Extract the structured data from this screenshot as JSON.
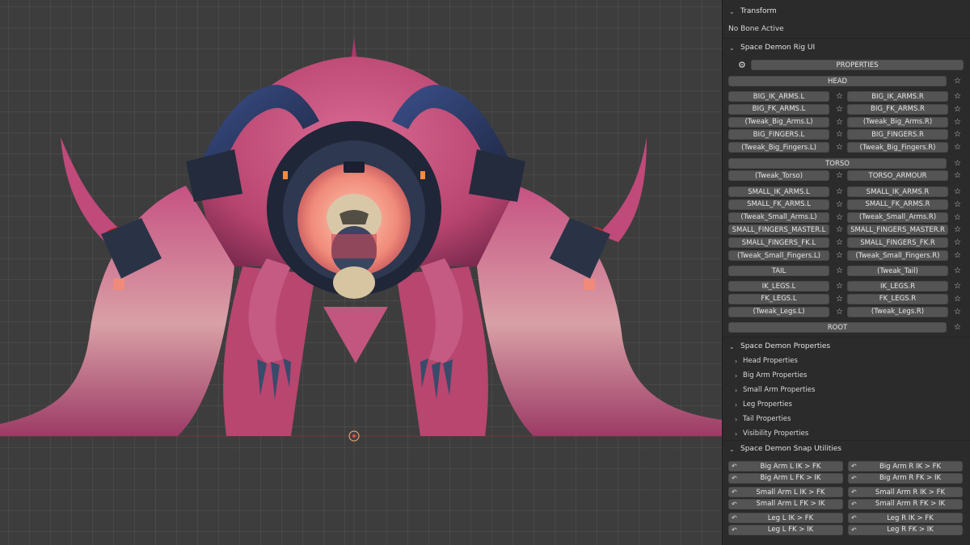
{
  "viewport": {
    "scene_subject": "space-demon-creature-model",
    "colors": {
      "skin": "#c8507e",
      "armour": "#2a3346",
      "glow": "#f08a7a",
      "background": "#3d3d3d"
    }
  },
  "panel": {
    "transform": {
      "title": "Transform",
      "status": "No Bone Active"
    },
    "rig_ui": {
      "title": "Space Demon Rig UI",
      "properties_label": "PROPERTIES",
      "head_label": "HEAD",
      "big_rows": [
        [
          "BIG_IK_ARMS.L",
          "BIG_IK_ARMS.R"
        ],
        [
          "BIG_FK_ARMS.L",
          "BIG_FK_ARMS.R"
        ],
        [
          "(Tweak_Big_Arms.L)",
          "(Tweak_Big_Arms.R)"
        ],
        [
          "BIG_FINGERS.L",
          "BIG_FINGERS.R"
        ],
        [
          "(Tweak_Big_Fingers.L)",
          "(Tweak_Big_Fingers.R)"
        ]
      ],
      "torso_label": "TORSO",
      "torso_row": [
        "(Tweak_Torso)",
        "TORSO_ARMOUR"
      ],
      "small_rows": [
        [
          "SMALL_IK_ARMS.L",
          "SMALL_IK_ARMS.R"
        ],
        [
          "SMALL_FK_ARMS.L",
          "SMALL_FK_ARMS.R"
        ],
        [
          "(Tweak_Small_Arms.L)",
          "(Tweak_Small_Arms.R)"
        ],
        [
          "SMALL_FINGERS_MASTER.L",
          "SMALL_FINGERS_MASTER.R"
        ],
        [
          "SMALL_FINGERS_FK.L",
          "SMALL_FINGERS_FK.R"
        ],
        [
          "(Tweak_Small_Fingers.L)",
          "(Tweak_Small_Fingers.R)"
        ]
      ],
      "tail_row": [
        "TAIL",
        "(Tweak_Tail)"
      ],
      "leg_rows": [
        [
          "IK_LEGS.L",
          "IK_LEGS.R"
        ],
        [
          "FK_LEGS.L",
          "FK_LEGS.R"
        ],
        [
          "(Tweak_Legs.L)",
          "(Tweak_Legs.R)"
        ]
      ],
      "root_label": "ROOT"
    },
    "properties": {
      "title": "Space Demon Properties",
      "items": [
        "Head Properties",
        "Big Arm Properties",
        "Small Arm Properties",
        "Leg Properties",
        "Tail Properties",
        "Visibility Properties"
      ]
    },
    "snap": {
      "title": "Space Demon Snap Utilities",
      "groups": [
        [
          [
            "Big Arm L IK > FK",
            "Big Arm R IK > FK"
          ],
          [
            "Big Arm L FK > IK",
            "Big Arm R FK > IK"
          ]
        ],
        [
          [
            "Small Arm L IK > FK",
            "Small Arm R IK > FK"
          ],
          [
            "Small Arm L FK > IK",
            "Small Arm R FK > IK"
          ]
        ],
        [
          [
            "Leg L IK > FK",
            "Leg R IK > FK"
          ],
          [
            "Leg L FK > IK",
            "Leg R FK > IK"
          ]
        ]
      ]
    },
    "icons": {
      "collapse": "chevron-down-icon",
      "expand": "chevron-right-icon",
      "favorite": "star-icon",
      "settings": "gear-icon",
      "snap": "snap-magnet-icon"
    }
  }
}
